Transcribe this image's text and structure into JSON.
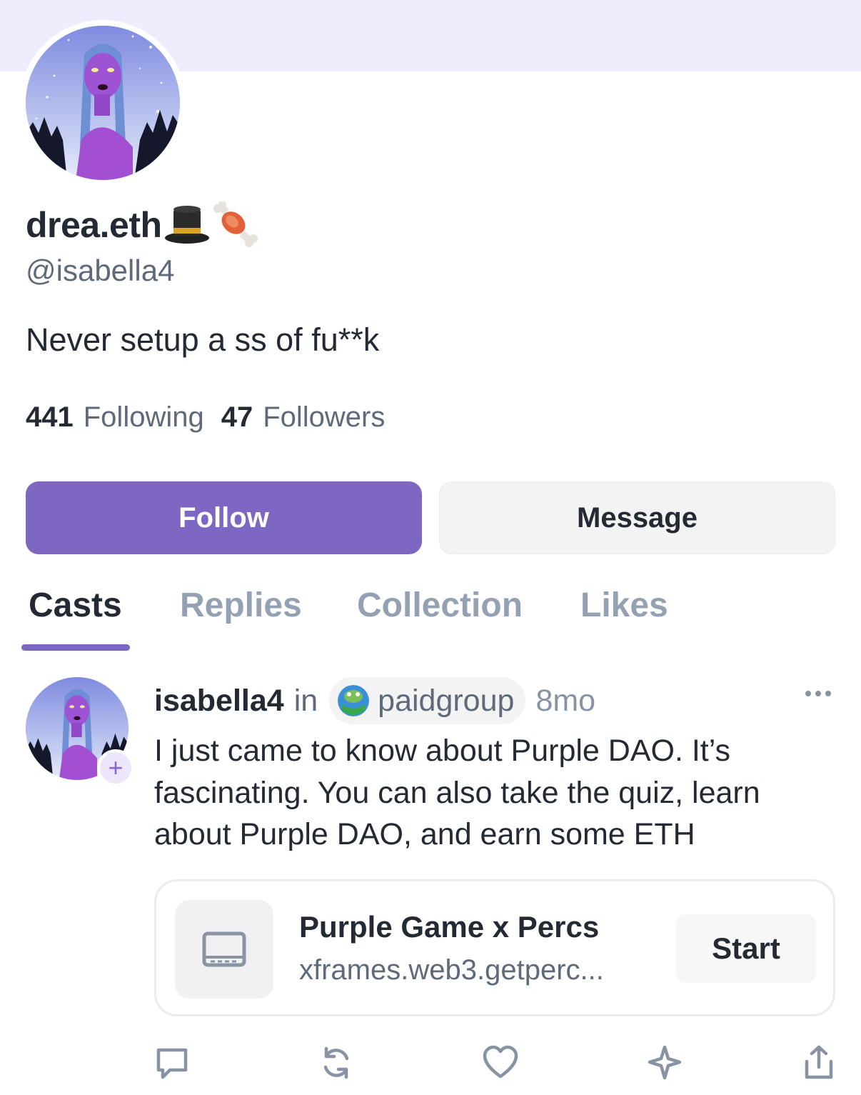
{
  "profile": {
    "display_name": "drea.eth",
    "name_emojis": [
      "top-hat",
      "meat-on-bone"
    ],
    "handle": "@isabella4",
    "bio": "Never setup a ss of fu**k",
    "following_count": "441",
    "following_label": "Following",
    "followers_count": "47",
    "followers_label": "Followers"
  },
  "buttons": {
    "follow": "Follow",
    "message": "Message"
  },
  "tabs": [
    {
      "label": "Casts",
      "active": true
    },
    {
      "label": "Replies",
      "active": false
    },
    {
      "label": "Collection",
      "active": false
    },
    {
      "label": "Likes",
      "active": false
    }
  ],
  "post": {
    "author": "isabella4",
    "in_label": "in",
    "channel": "paidgroup",
    "time": "8mo",
    "text": "I just came to know about Purple DAO. It’s fascinating. You can also take the quiz, learn about Purple DAO, and earn some ETH",
    "plus_badge": "+",
    "frame": {
      "title": "Purple Game x Percs",
      "url": "xframes.web3.getperc...",
      "button": "Start"
    },
    "actions": [
      "reply-icon",
      "recast-icon",
      "like-icon",
      "bookmark-icon",
      "share-icon"
    ]
  },
  "colors": {
    "accent": "#7e66c3",
    "cover": "#efecfd",
    "text_primary": "#232a33",
    "text_secondary": "#5e6a7a",
    "tab_inactive": "#94a1b2"
  }
}
